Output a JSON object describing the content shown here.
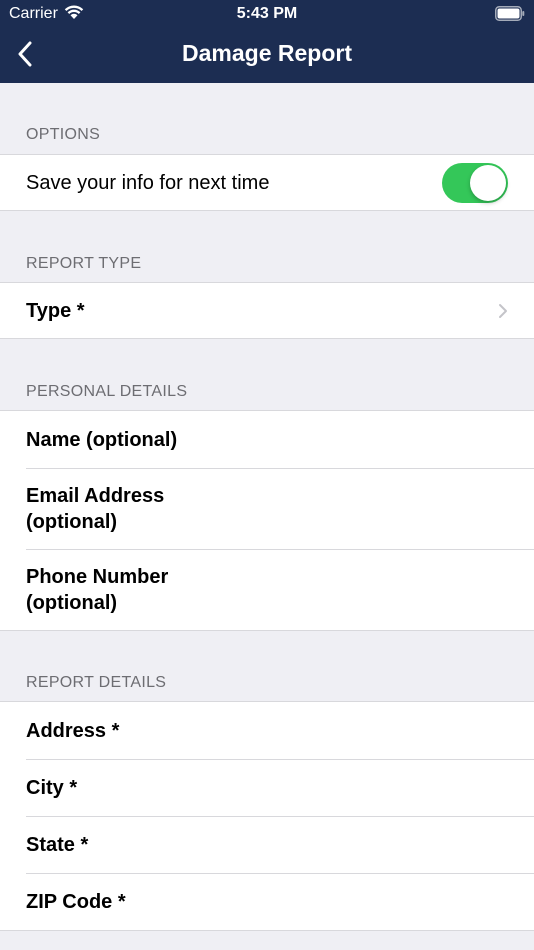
{
  "status_bar": {
    "carrier": "Carrier",
    "time": "5:43 PM"
  },
  "nav": {
    "title": "Damage Report",
    "back_icon": "chevron-left-icon"
  },
  "colors": {
    "nav_bg": "#1c2d52",
    "toggle_on": "#34c759",
    "background": "#efeff4"
  },
  "options": {
    "header": "OPTIONS",
    "save_info_label": "Save your info for next time",
    "save_info_enabled": true
  },
  "report_type": {
    "header": "REPORT TYPE",
    "type_label": "Type *"
  },
  "personal_details": {
    "header": "PERSONAL DETAILS",
    "name_label": "Name (optional)",
    "email_label_line1": "Email Address",
    "email_label_line2": "(optional)",
    "phone_label_line1": "Phone Number",
    "phone_label_line2": "(optional)"
  },
  "report_details": {
    "header": "REPORT DETAILS",
    "address_label": "Address *",
    "city_label": "City *",
    "state_label": "State *",
    "zip_label": "ZIP Code *"
  }
}
